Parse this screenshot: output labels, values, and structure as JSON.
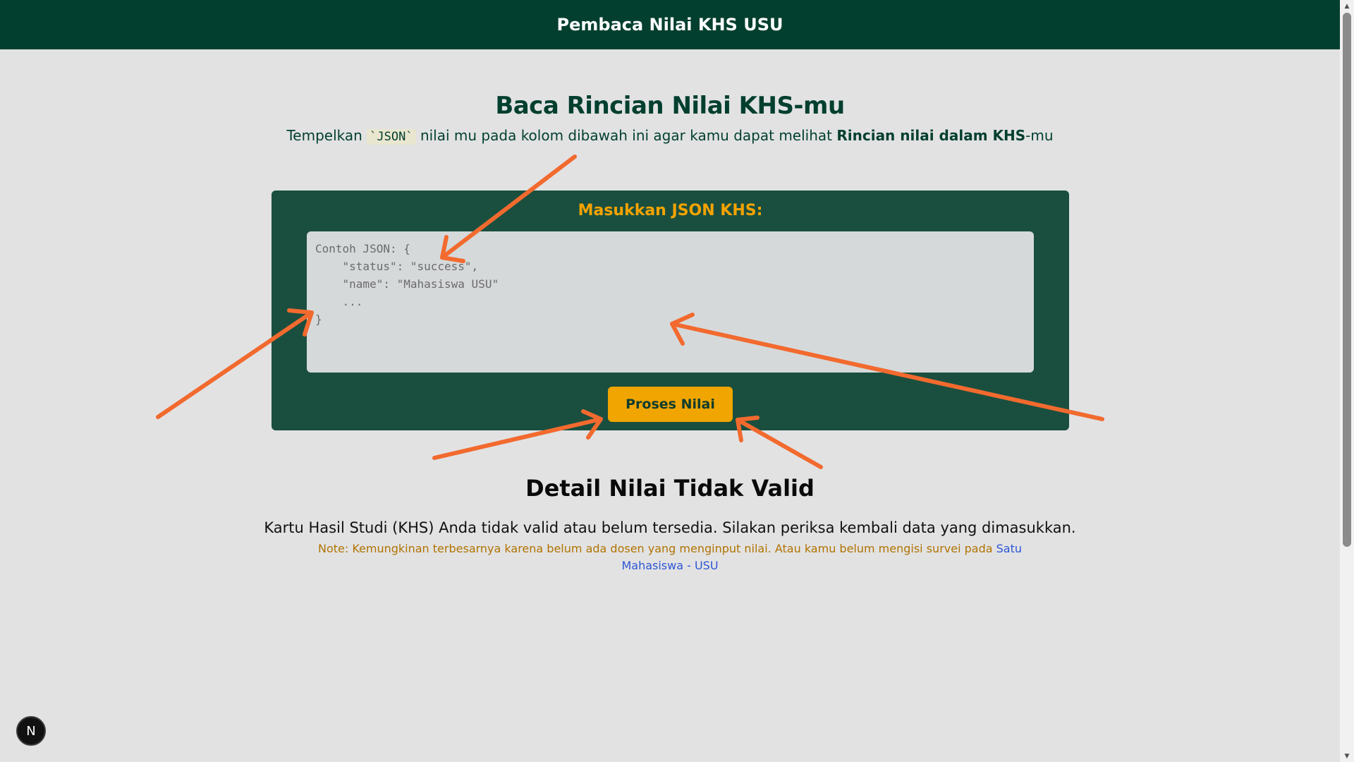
{
  "header": {
    "title": "Pembaca Nilai KHS USU"
  },
  "intro": {
    "title": "Baca Rincian Nilai KHS-mu",
    "subtitle_prefix": "Tempelkan",
    "subtitle_code": "`JSON`",
    "subtitle_middle": "nilai mu pada kolom dibawah ini agar kamu dapat melihat",
    "subtitle_bold": "Rincian nilai dalam KHS",
    "subtitle_suffix": "-mu"
  },
  "input_card": {
    "heading": "Masukkan JSON KHS:",
    "placeholder": "Contoh JSON: {\n    \"status\": \"success\",\n    \"name\": \"Mahasiswa USU\"\n    ...\n}",
    "button_label": "Proses Nilai"
  },
  "result": {
    "title": "Detail Nilai Tidak Valid",
    "message": "Kartu Hasil Studi (KHS) Anda tidak valid atau belum tersedia. Silakan periksa kembali data yang dimasukkan.",
    "note_text": "Note: Kemungkinan terbesarnya karena belum ada dosen yang menginput nilai. Atau kamu belum mengisi survei pada",
    "note_link": "Satu Mahasiswa - USU"
  },
  "dev_badge": {
    "label": "N"
  },
  "colors": {
    "header_bg": "#023f2f",
    "card_bg": "#1a4f3f",
    "accent": "#f0a500",
    "annotation_arrow": "#f26a2e",
    "link": "#2d56d6"
  }
}
